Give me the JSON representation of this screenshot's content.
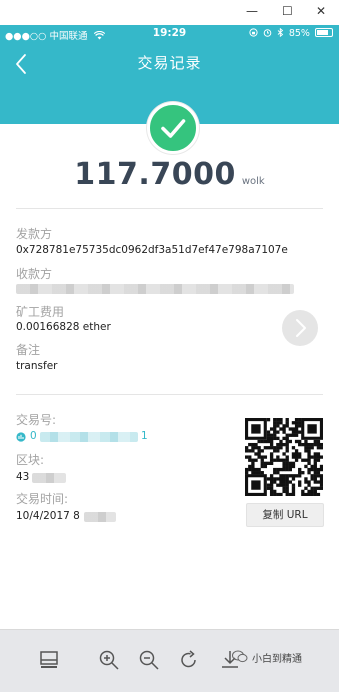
{
  "window": {
    "minimize_glyph": "—",
    "maximize_glyph": "☐",
    "close_glyph": "✕"
  },
  "status_bar": {
    "carrier": "●●●○○ 中国联通",
    "wifi_icon": "wifi-icon",
    "time": "19:29",
    "battery_percent": "85%",
    "battery_level": 0.85
  },
  "header": {
    "title": "交易记录",
    "back_glyph": "‹"
  },
  "transaction": {
    "amount": "117.7000",
    "unit": "wolk",
    "status_icon": "success-check-icon",
    "status_color": "#35c47e"
  },
  "details": {
    "sender_label": "发款方",
    "sender_value": "0x728781e75735dc0962df3a51d7ef47e798a7107e",
    "receiver_label": "收款方",
    "fee_label": "矿工费用",
    "fee_value": "0.00166828 ether",
    "memo_label": "备注",
    "memo_value": "transfer",
    "tx_hash_label": "交易号:",
    "tx_hash_value_visible": "0",
    "tx_hash_value_tail": "1",
    "block_label": "区块:",
    "block_value_visible": "43",
    "time_label": "交易时间:",
    "time_value_visible": "10/4/2017 8"
  },
  "actions": {
    "copy_url_label": "复制 URL"
  },
  "toolbar": {
    "watermark": "小白到精通"
  },
  "colors": {
    "accent": "#35b8c9",
    "success": "#35c47e",
    "text_primary": "#394656",
    "label": "#a3a3a3"
  }
}
